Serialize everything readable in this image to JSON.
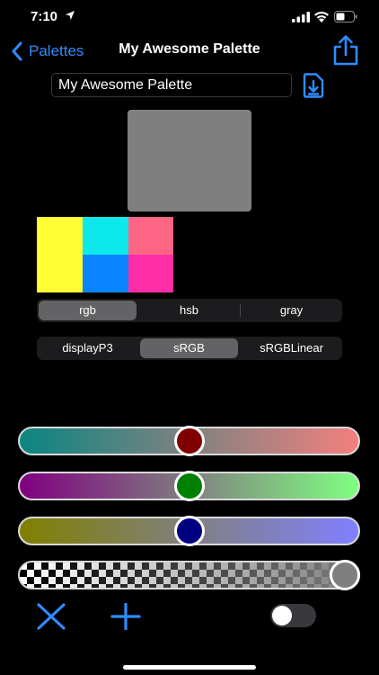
{
  "status": {
    "time": "7:10"
  },
  "nav": {
    "back_label": "Palettes",
    "title": "My Awesome Palette"
  },
  "name_field": {
    "value": "My Awesome Palette"
  },
  "main_swatch": {
    "color": "#7f7f7f"
  },
  "palette": [
    {
      "color": "#fffd33"
    },
    {
      "color": "#0de8ec"
    },
    {
      "color": "#fd6585"
    },
    {
      "color": "#0a84ff"
    },
    {
      "color": "#ff2ea6"
    }
  ],
  "model_segments": {
    "items": [
      "rgb",
      "hsb",
      "gray"
    ],
    "selected": "rgb"
  },
  "space_segments": {
    "items": [
      "displayP3",
      "sRGB",
      "sRGBLinear"
    ],
    "selected": "sRGB"
  },
  "sliders": [
    {
      "channel": "red",
      "value": 0.5,
      "from": "#0b8582",
      "to": "#f47f7f",
      "thumb_color": "#800000"
    },
    {
      "channel": "green",
      "value": 0.5,
      "from": "#800080",
      "to": "#80ff80",
      "thumb_color": "#008000"
    },
    {
      "channel": "blue",
      "value": 0.5,
      "from": "#808000",
      "to": "#8080ff",
      "thumb_color": "#000080"
    },
    {
      "channel": "alpha",
      "value": 1.0,
      "thumb_color": "#7f7f7f"
    }
  ],
  "toolbar": {
    "delete_icon": "close-icon",
    "add_icon": "plus-icon",
    "toggle_on": false
  },
  "colors": {
    "accent": "#2f8cff",
    "background": "#000000"
  }
}
